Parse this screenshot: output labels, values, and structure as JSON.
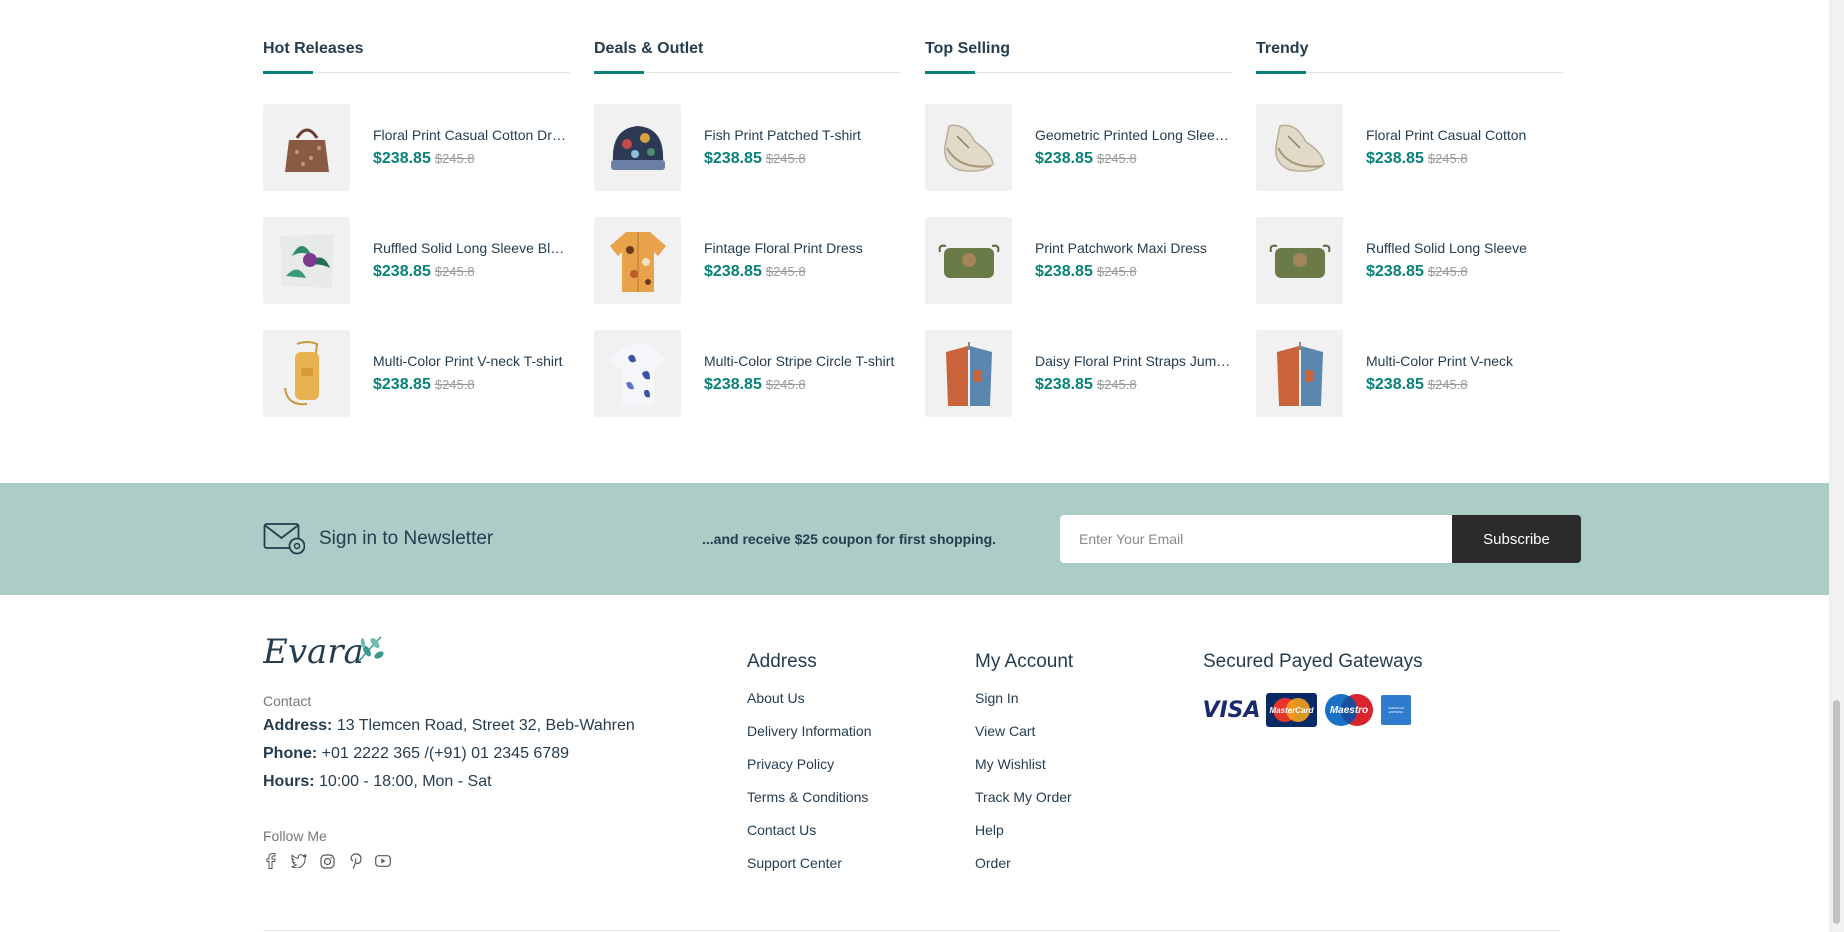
{
  "columns": [
    {
      "title": "Hot Releases",
      "items": [
        {
          "name": "Floral Print Casual Cotton Dress",
          "price": "$238.85",
          "old_price": "$245.8",
          "image": "handbag-leopard"
        },
        {
          "name": "Ruffled Solid Long Sleeve Blouse",
          "price": "$238.85",
          "old_price": "$245.8",
          "image": "tropical-pillow"
        },
        {
          "name": "Multi-Color Print V-neck T-shirt",
          "price": "$238.85",
          "old_price": "$245.8",
          "image": "yellow-phone-bag"
        }
      ]
    },
    {
      "title": "Deals & Outlet",
      "items": [
        {
          "name": "Fish Print Patched T-shirt",
          "price": "$238.85",
          "old_price": "$245.8",
          "image": "beanie-hat"
        },
        {
          "name": "Fintage Floral Print Dress",
          "price": "$238.85",
          "old_price": "$245.8",
          "image": "floral-shirt"
        },
        {
          "name": "Multi-Color Stripe Circle T-shirt",
          "price": "$238.85",
          "old_price": "$245.8",
          "image": "blue-white-shirt"
        }
      ]
    },
    {
      "title": "Top Selling",
      "items": [
        {
          "name": "Geometric Printed Long Sleeve Blouse",
          "price": "$238.85",
          "old_price": "$245.8",
          "image": "sneaker"
        },
        {
          "name": "Print Patchwork Maxi Dress",
          "price": "$238.85",
          "old_price": "$245.8",
          "image": "green-bag"
        },
        {
          "name": "Daisy Floral Print Straps Jumpsuit",
          "price": "$238.85",
          "old_price": "$245.8",
          "image": "denim-shirt"
        }
      ]
    },
    {
      "title": "Trendy",
      "items": [
        {
          "name": "Floral Print Casual Cotton",
          "price": "$238.85",
          "old_price": "$245.8",
          "image": "sneaker"
        },
        {
          "name": "Ruffled Solid Long Sleeve",
          "price": "$238.85",
          "old_price": "$245.8",
          "image": "green-bag"
        },
        {
          "name": "Multi-Color Print V-neck",
          "price": "$238.85",
          "old_price": "$245.8",
          "image": "denim-shirt"
        }
      ]
    }
  ],
  "newsletter": {
    "title": "Sign in to Newsletter",
    "subtitle": "...and receive $25 coupon for first shopping.",
    "placeholder": "Enter Your Email",
    "button": "Subscribe",
    "icon": "mail-at-icon"
  },
  "footer": {
    "brand": "Evara",
    "contact_label": "Contact",
    "address_label": "Address:",
    "address": "13 Tlemcen Road, Street 32, Beb-Wahren",
    "phone_label": "Phone:",
    "phone": "+01 2222 365 /(+91) 01 2345 6789",
    "hours_label": "Hours:",
    "hours": "10:00 - 18:00, Mon - Sat",
    "follow_label": "Follow Me",
    "socials": [
      "facebook-icon",
      "twitter-icon",
      "instagram-icon",
      "pinterest-icon",
      "youtube-icon"
    ],
    "address_col": {
      "title": "Address",
      "links": [
        "About Us",
        "Delivery Information",
        "Privacy Policy",
        "Terms & Conditions",
        "Contact Us",
        "Support Center"
      ]
    },
    "account_col": {
      "title": "My Account",
      "links": [
        "Sign In",
        "View Cart",
        "My Wishlist",
        "Track My Order",
        "Help",
        "Order"
      ]
    },
    "payments": {
      "title": "Secured Payed Gateways",
      "cards": [
        "VISA",
        "MasterCard",
        "Maestro",
        "AMERICAN EXPRESS"
      ]
    }
  },
  "colors": {
    "accent": "#088178",
    "newsletter_bg": "#abccc7",
    "dark": "#253d4e"
  }
}
